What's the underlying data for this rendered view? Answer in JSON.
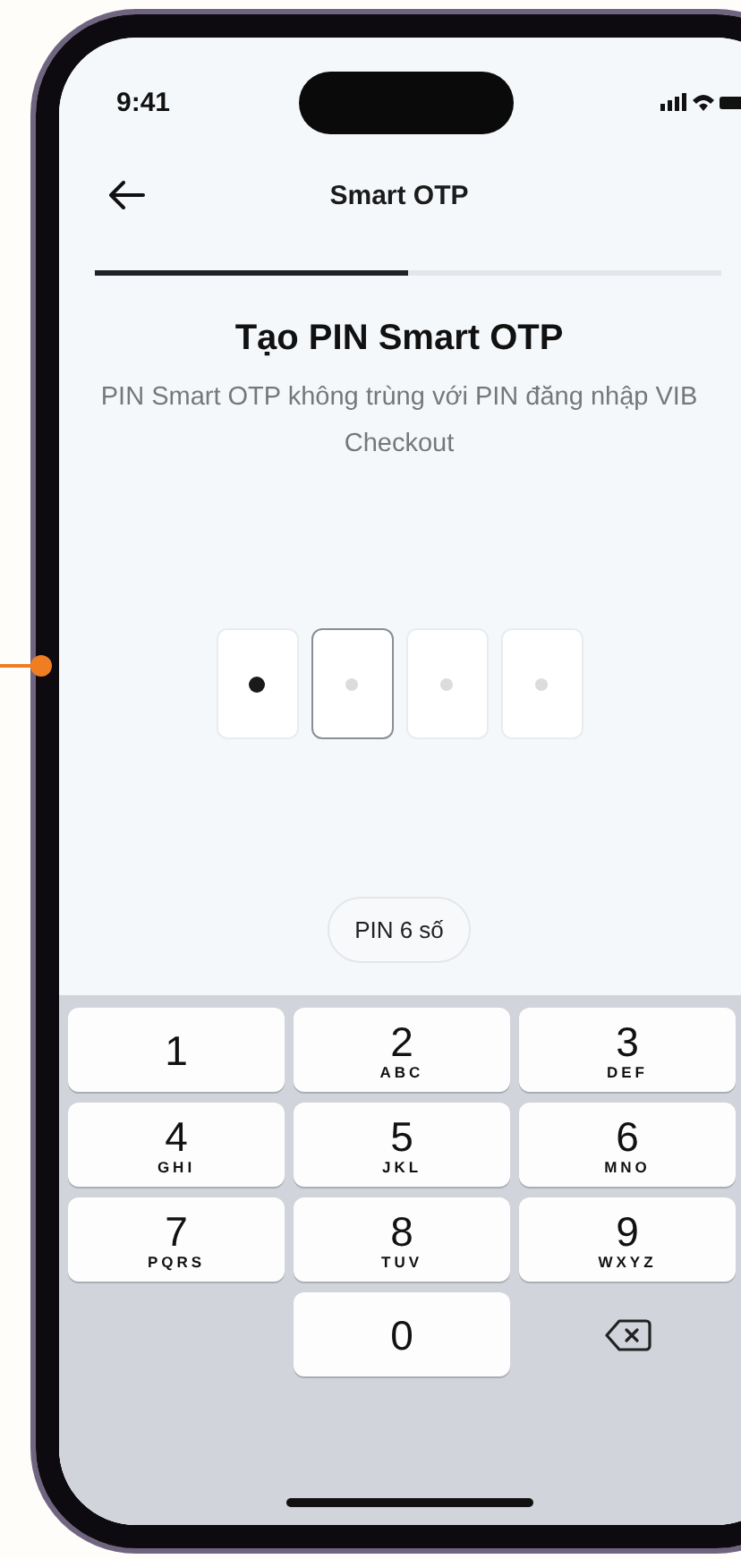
{
  "status_bar": {
    "time": "9:41"
  },
  "header": {
    "title": "Smart OTP"
  },
  "progress": {
    "level": 0.5
  },
  "title": "Tạo PIN Smart OTP",
  "subtitle": "PIN Smart OTP không trùng với PIN đăng nhập VIB Checkout",
  "pin_cells": [
    {
      "filled": true,
      "selected": false
    },
    {
      "filled": false,
      "selected": true
    },
    {
      "filled": false,
      "selected": false
    },
    {
      "filled": false,
      "selected": false
    }
  ],
  "pin_length_button": "PIN 6 số",
  "keypad": [
    {
      "kind": "digit",
      "digit": "1"
    },
    {
      "kind": "digit",
      "digit": "2",
      "letters": "ABC"
    },
    {
      "kind": "digit",
      "digit": "3",
      "letters": "DEF"
    },
    {
      "kind": "digit",
      "digit": "4",
      "letters": "GHI"
    },
    {
      "kind": "digit",
      "digit": "5",
      "letters": "JKL"
    },
    {
      "kind": "digit",
      "digit": "6",
      "letters": "MNO"
    },
    {
      "kind": "digit",
      "digit": "7",
      "letters": "PQRS"
    },
    {
      "kind": "digit",
      "digit": "8",
      "letters": "TUV"
    },
    {
      "kind": "digit",
      "digit": "9",
      "letters": "WXYZ"
    },
    {
      "kind": "blank"
    },
    {
      "kind": "digit",
      "digit": "0"
    },
    {
      "kind": "backspace"
    }
  ]
}
